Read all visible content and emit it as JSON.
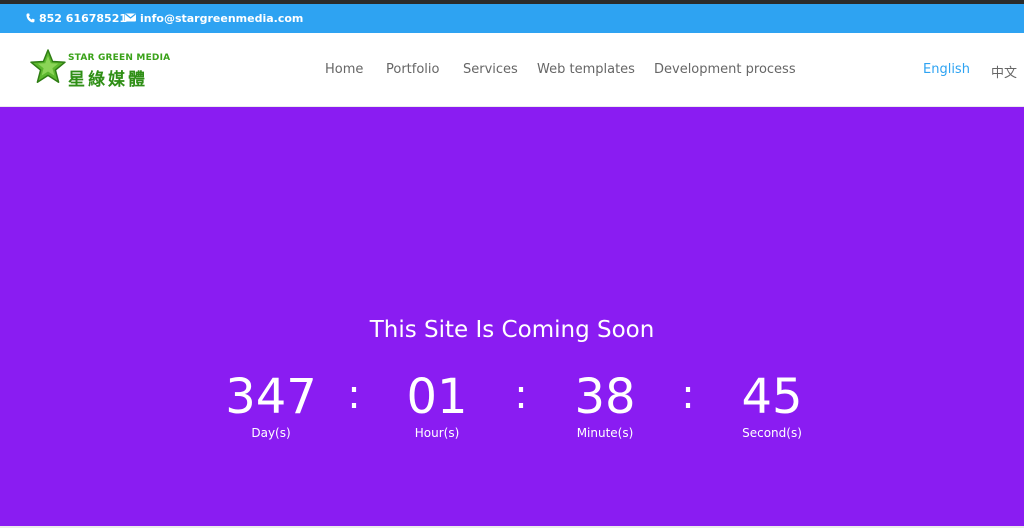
{
  "topbar": {
    "phone": "852 61678521",
    "email": "info@stargreenmedia.com",
    "phone_icon": "phone-icon",
    "email_icon": "envelope-icon",
    "background": "#2ea3f2"
  },
  "logo": {
    "name_en": "STAR GREEN MEDIA",
    "name_zh": "星綠媒體",
    "icon": "green-star-logo"
  },
  "nav": {
    "items": [
      {
        "label": "Home"
      },
      {
        "label": "Portfolio"
      },
      {
        "label": "Services"
      },
      {
        "label": "Web templates"
      },
      {
        "label": "Development process"
      }
    ]
  },
  "languages": {
    "english": "English",
    "chinese": "中文",
    "active_color": "#2ea3f2"
  },
  "hero": {
    "background": "#8a1cf2",
    "title": "This Site Is Coming Soon",
    "separator": ":",
    "countdown": {
      "days": {
        "value": "347",
        "label": "Day(s)"
      },
      "hours": {
        "value": "01",
        "label": "Hour(s)"
      },
      "minutes": {
        "value": "38",
        "label": "Minute(s)"
      },
      "seconds": {
        "value": "45",
        "label": "Second(s)"
      }
    }
  }
}
